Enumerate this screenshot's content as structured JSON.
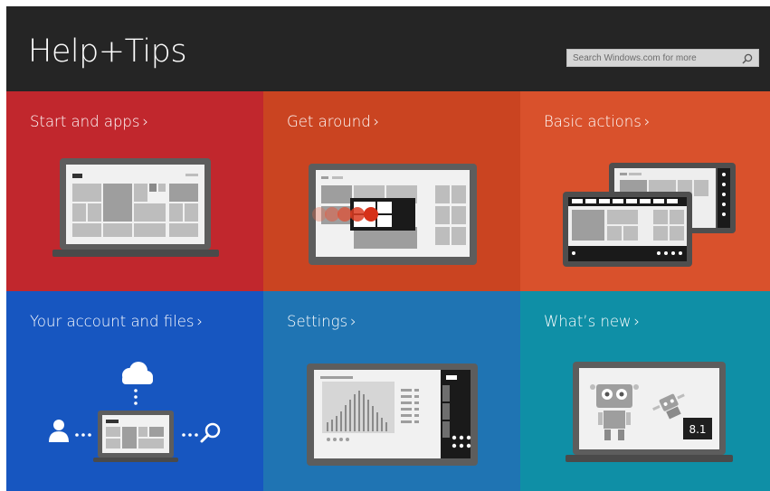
{
  "app": {
    "title": "Help+Tips",
    "search": {
      "placeholder": "Search Windows.com for more"
    }
  },
  "tiles": [
    {
      "label": "Start and apps",
      "chevron": "›",
      "color": "#c1272d"
    },
    {
      "label": "Get around",
      "chevron": "›",
      "color": "#ca4421"
    },
    {
      "label": "Basic actions",
      "chevron": "›",
      "color": "#d9512c"
    },
    {
      "label": "Your account and files",
      "chevron": "›",
      "color": "#1756c0"
    },
    {
      "label": "Settings",
      "chevron": "›",
      "color": "#1f74b3"
    },
    {
      "label": "What’s new",
      "chevron": "›",
      "color": "#0f8fa6"
    }
  ],
  "whats_new": {
    "version_badge": "8.1"
  },
  "icons": {
    "search": "search-icon",
    "cloud": "cloud-icon",
    "user": "user-icon",
    "magnifier": "magnifier-icon"
  }
}
